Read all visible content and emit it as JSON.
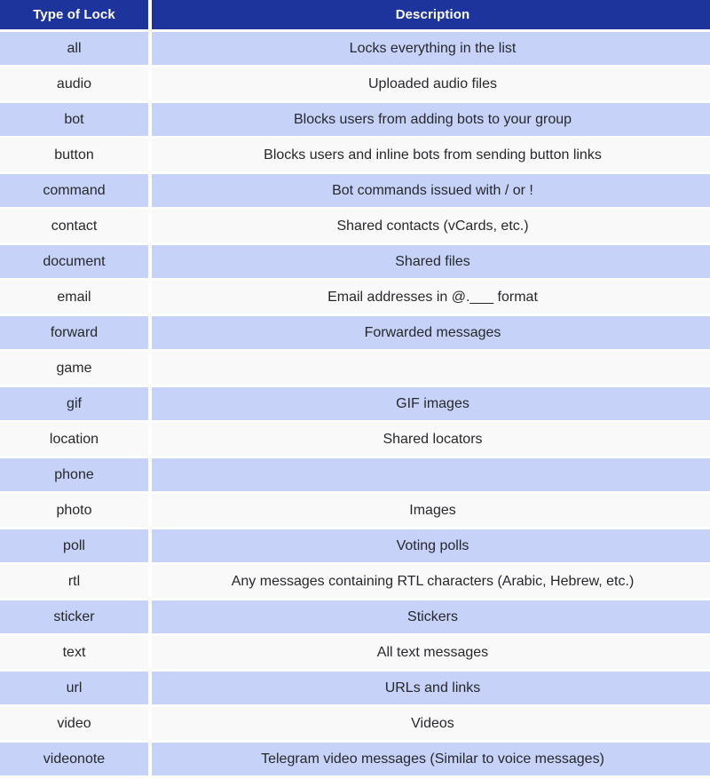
{
  "table": {
    "columns": [
      {
        "key": "type",
        "label": "Type of Lock"
      },
      {
        "key": "description",
        "label": "Description"
      }
    ],
    "header_bg": "#1c349b",
    "header_text_color": "#ffffff",
    "row_shaded_bg": "#c6d2f7",
    "row_plain_bg": "#f9f9f9",
    "rows": [
      {
        "type": "all",
        "description": "Locks everything in the list"
      },
      {
        "type": "audio",
        "description": "Uploaded audio files"
      },
      {
        "type": "bot",
        "description": "Blocks users from adding bots to your group"
      },
      {
        "type": "button",
        "description": "Blocks users and inline bots from sending button links"
      },
      {
        "type": "command",
        "description": "Bot commands issued with / or !"
      },
      {
        "type": "contact",
        "description": "Shared contacts (vCards, etc.)"
      },
      {
        "type": "document",
        "description": "Shared files"
      },
      {
        "type": "email",
        "description": "Email addresses in @.___ format"
      },
      {
        "type": "forward",
        "description": "Forwarded messages"
      },
      {
        "type": "game",
        "description": ""
      },
      {
        "type": "gif",
        "description": "GIF images"
      },
      {
        "type": "location",
        "description": "Shared locators"
      },
      {
        "type": "phone",
        "description": ""
      },
      {
        "type": "photo",
        "description": "Images"
      },
      {
        "type": "poll",
        "description": "Voting polls"
      },
      {
        "type": "rtl",
        "description": "Any messages containing RTL characters (Arabic, Hebrew, etc.)"
      },
      {
        "type": "sticker",
        "description": "Stickers"
      },
      {
        "type": "text",
        "description": "All text messages"
      },
      {
        "type": "url",
        "description": "URLs and links"
      },
      {
        "type": "video",
        "description": "Videos"
      },
      {
        "type": "videonote",
        "description": "Telegram video messages (Similar to voice messages)"
      }
    ]
  }
}
